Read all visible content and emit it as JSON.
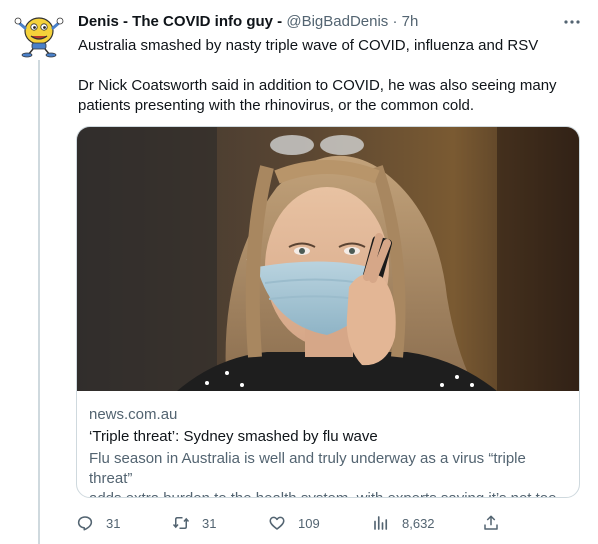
{
  "tweet": {
    "author_name": "Denis - The COVID info guy -",
    "handle": "@BigBadDenis",
    "separator": "·",
    "time": "7h",
    "text_line1": "Australia smashed by nasty triple wave of COVID, influenza and RSV",
    "text_para2": "Dr Nick Coatsworth said in addition to COVID, he was also seeing many patients presenting with the rhinovirus, or the common cold."
  },
  "card": {
    "domain": "news.com.au",
    "title": "‘Triple threat’: Sydney smashed by flu wave",
    "description_line1": "Flu season in Australia is well and truly underway as a virus “triple threat”",
    "description_line2": "adds extra burden to the health system, with experts saying it’s not too ..."
  },
  "actions": {
    "reply_count": "31",
    "retweet_count": "31",
    "like_count": "109",
    "views_count": "8,632"
  },
  "icons": {
    "avatar": "cartoon-germ-mascot-icon",
    "more": "more-horizontal-icon",
    "reply": "reply-icon",
    "retweet": "retweet-icon",
    "like": "heart-icon",
    "views": "views-chart-icon",
    "share": "share-icon"
  },
  "colors": {
    "text": "#0f1419",
    "secondary": "#536471",
    "border": "#cfd9de"
  }
}
